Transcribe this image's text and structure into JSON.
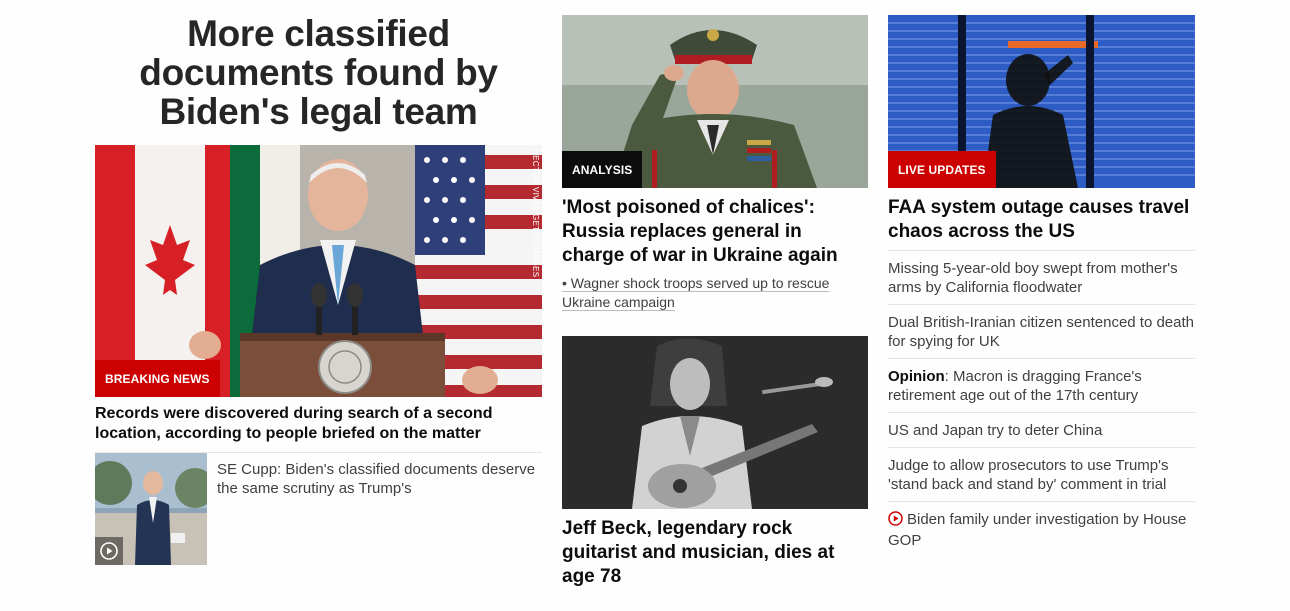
{
  "column1": {
    "headline": "More classified documents found by Biden's legal team",
    "hero": {
      "badge": "BREAKING NEWS",
      "credit": "HECTOR VIVAS/GETTY IMAGES",
      "caption": "Records were discovered during search of a second location, according to people briefed on the matter"
    },
    "related": {
      "text": "SE Cupp: Biden's classified documents deserve the same scrutiny as Trump's"
    }
  },
  "column2": {
    "story1": {
      "badge": "ANALYSIS",
      "headline": "'Most poisoned of chalices': Russia replaces general in charge of war in Ukraine again",
      "bullet": "• Wagner shock troops served up to rescue Ukraine campaign"
    },
    "story2": {
      "headline": "Jeff Beck, legendary rock guitarist and musician, dies at age 78"
    }
  },
  "column3": {
    "top": {
      "badge": "LIVE UPDATES",
      "headline": "FAA system outage causes travel chaos across the US"
    },
    "items": [
      {
        "text": "Missing 5-year-old boy swept from mother's arms by California floodwater"
      },
      {
        "text": "Dual British-Iranian citizen sentenced to death for spying for UK"
      },
      {
        "prefix": "Opinion",
        "text": ": Macron is dragging France's retirement age out of the 17th century"
      },
      {
        "text": "US and Japan try to deter China"
      },
      {
        "text": "Judge to allow prosecutors to use Trump's 'stand back and stand by' comment in trial"
      },
      {
        "text": "Biden family under investigation by House GOP",
        "icon": "play-circle-icon"
      }
    ]
  },
  "colors": {
    "breaking": "#cc0000",
    "analysis": "#0c0c0c",
    "text": "#0c0c0c",
    "muted": "#404040",
    "divider": "#e6e6e6"
  }
}
